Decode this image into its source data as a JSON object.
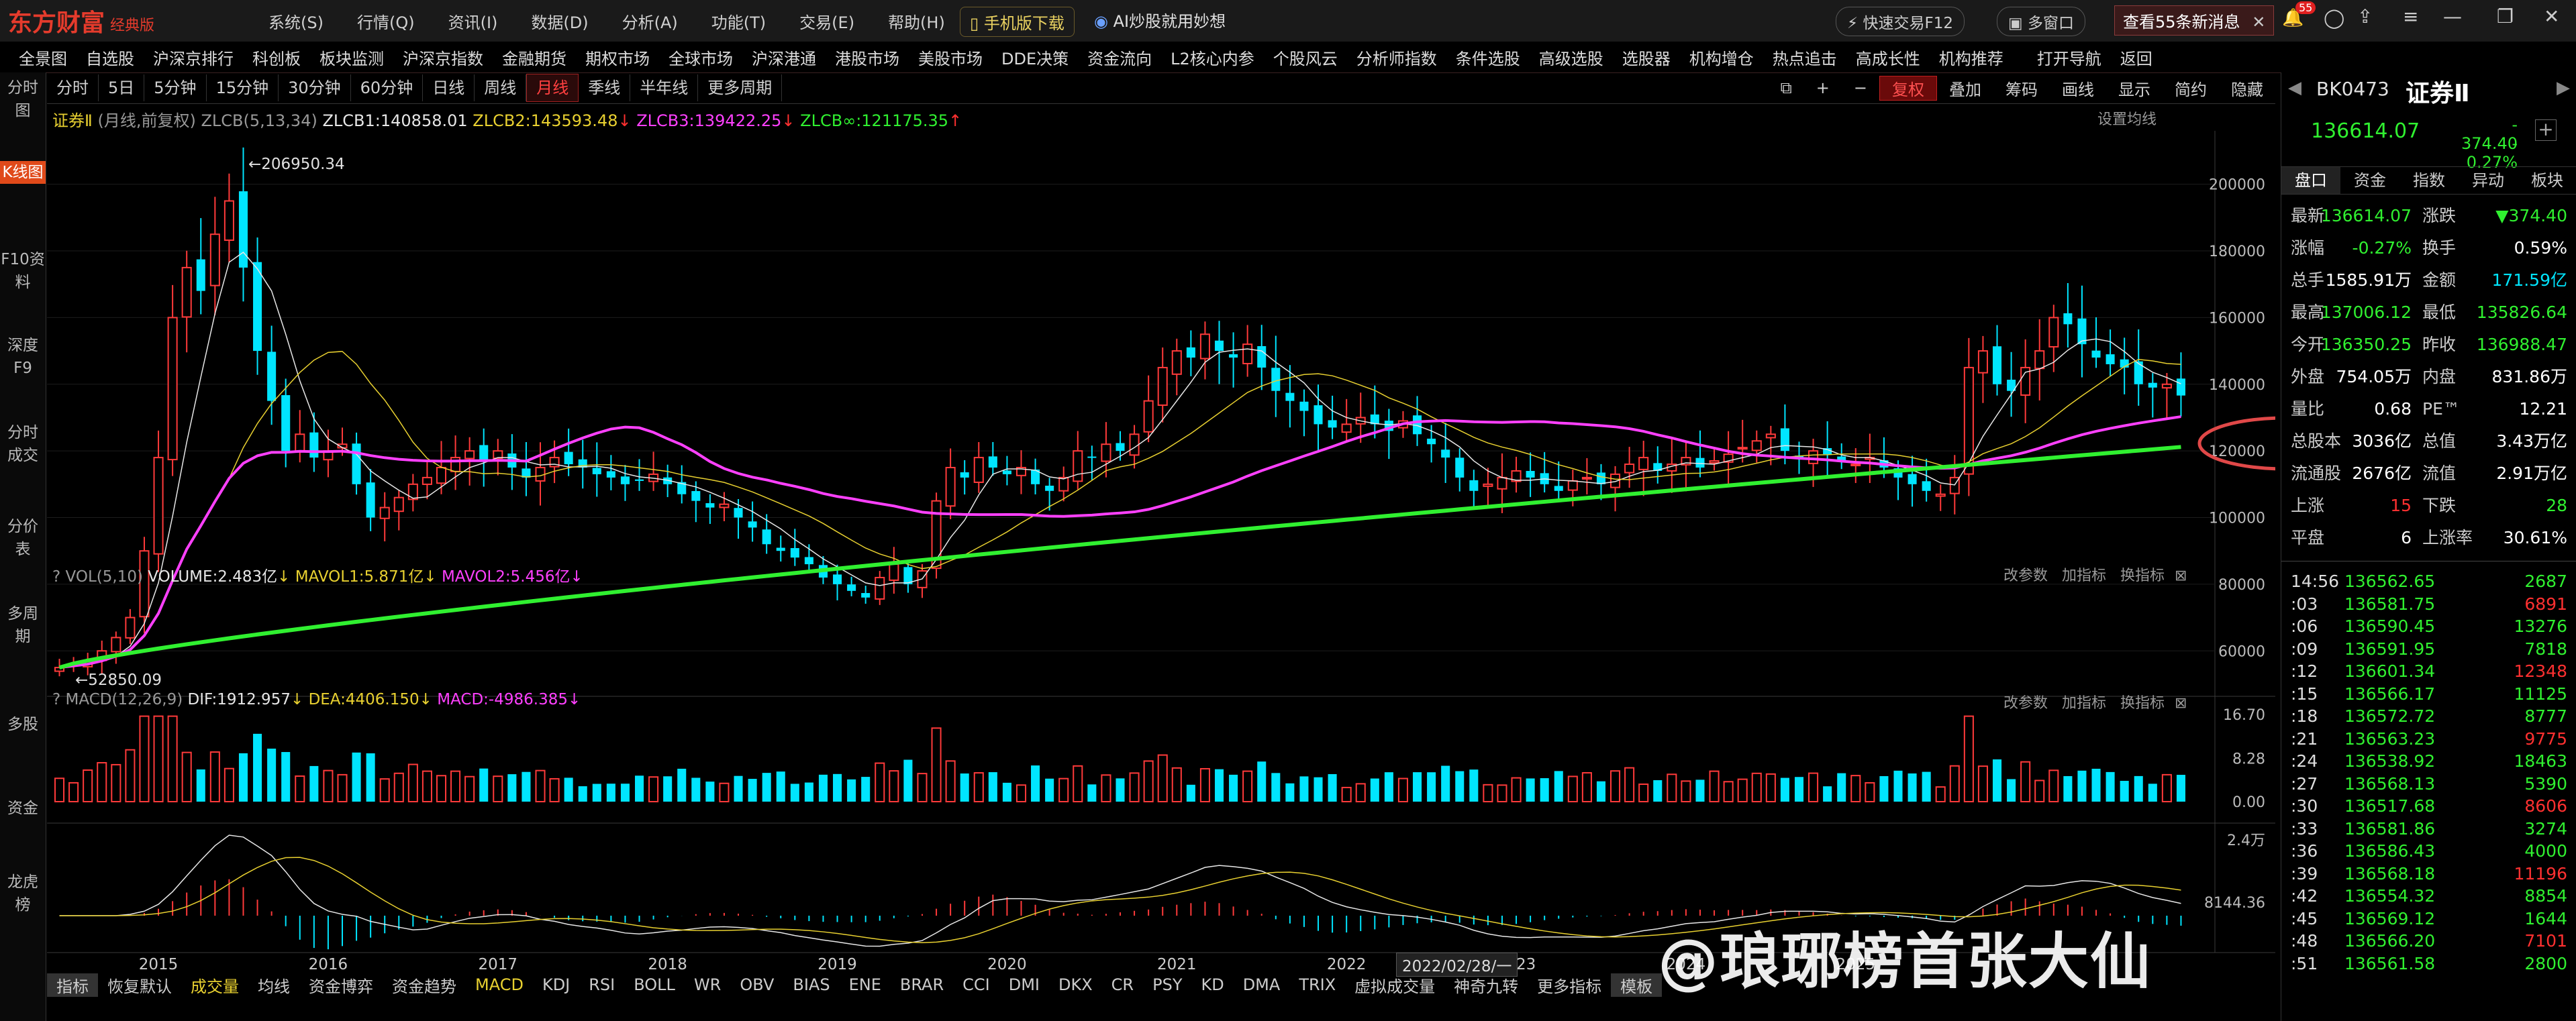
{
  "app": {
    "name": "东方财富",
    "edition": "经典版"
  },
  "menus": [
    "系统(S)",
    "行情(Q)",
    "资讯(I)",
    "数据(D)",
    "分析(A)",
    "功能(T)",
    "交易(E)",
    "帮助(H)"
  ],
  "title_actions": {
    "mobile": "手机版下载",
    "ai": "AI炒股就用妙想",
    "quick_trade": "快速交易F12",
    "multi_window": "多窗口",
    "news": "查看55条新消息",
    "news_badge": "55"
  },
  "navbar": [
    "全景图",
    "自选股",
    "沪深京排行",
    "科创板",
    "板块监测",
    "沪深京指数",
    "金融期货",
    "期权市场",
    "全球市场",
    "沪深港通",
    "港股市场",
    "美股市场",
    "DDE决策",
    "资金流向",
    "L2核心内参",
    "个股风云",
    "分析师指数",
    "条件选股",
    "高级选股",
    "选股器",
    "机构增仓",
    "热点追击",
    "高成长性",
    "机构推荐",
    "打开导航",
    "返回"
  ],
  "left_tabs": [
    "分时图",
    "K线图",
    "F10资料",
    "深度F9",
    "分时成交",
    "分价表",
    "多周期",
    "多股",
    "资金",
    "龙虎榜"
  ],
  "timeframes": [
    "分时",
    "5日",
    "5分钟",
    "15分钟",
    "30分钟",
    "60分钟",
    "日线",
    "周线",
    "月线",
    "季线",
    "半年线",
    "更多周期"
  ],
  "timeframe_selected": "月线",
  "chart_tools": [
    "复权",
    "叠加",
    "筹码",
    "画线",
    "显示",
    "简约",
    "隐藏"
  ],
  "legend": {
    "name": "证券Ⅱ",
    "period": "(月线,前复权)",
    "indicator": "ZLCB(5,13,34)",
    "zlcb1": "ZLCB1:140858.01",
    "zlcb2": "ZLCB2:143593.48",
    "zlcb3": "ZLCB3:139422.25",
    "zlcbinf": "ZLCB∞:121175.35",
    "setting": "设置均线"
  },
  "vol_legend": {
    "name": "VOL(5,10)",
    "volume": "VOLUME:2.483亿",
    "mavol1": "MAVOL1:5.871亿",
    "mavol2": "MAVOL2:5.456亿"
  },
  "macd_legend": {
    "name": "MACD(12,26,9)",
    "dif": "DIF:1912.957",
    "dea": "DEA:4406.150",
    "macd": "MACD:-4986.385"
  },
  "panel_actions": [
    "改参数",
    "加指标",
    "换指标"
  ],
  "max_label": "206950.34",
  "min_label": "52850.09",
  "cursor_date": "2022/02/28/一",
  "bottom_tabs": [
    "指标",
    "恢复默认",
    "成交量",
    "均线",
    "资金博弈",
    "资金趋势",
    "MACD",
    "KDJ",
    "RSI",
    "BOLL",
    "WR",
    "OBV",
    "BIAS",
    "ENE",
    "BRAR",
    "CCI",
    "DMI",
    "DKX",
    "CR",
    "PSY",
    "KD",
    "DMA",
    "TRIX",
    "虚拟成交量",
    "神奇九转",
    "更多指标",
    "模板"
  ],
  "quote": {
    "code": "BK0473",
    "name": "证券Ⅱ",
    "price": "136614.07",
    "change": "- 374.40",
    "pct": "- 0.27%"
  },
  "panel_tabs": [
    "盘口",
    "资金",
    "指数",
    "异动",
    "板块"
  ],
  "stats": [
    {
      "k1": "最新",
      "v1": "136614.07",
      "k2": "涨跌",
      "v2": "▼374.40"
    },
    {
      "k1": "涨幅",
      "v1": "-0.27%",
      "k2": "换手",
      "v2": "0.59%"
    },
    {
      "k1": "总手",
      "v1": "1585.91万",
      "k2": "金额",
      "v2": "171.59亿"
    },
    {
      "k1": "最高",
      "v1": "137006.12",
      "k2": "最低",
      "v2": "135826.64"
    },
    {
      "k1": "今开",
      "v1": "136350.25",
      "k2": "昨收",
      "v2": "136988.47"
    },
    {
      "k1": "外盘",
      "v1": "754.05万",
      "k2": "内盘",
      "v2": "831.86万"
    },
    {
      "k1": "量比",
      "v1": "0.68",
      "k2": "PE™",
      "v2": "12.21"
    },
    {
      "k1": "总股本",
      "v1": "3036亿",
      "k2": "总值",
      "v2": "3.43万亿"
    },
    {
      "k1": "流通股",
      "v1": "2676亿",
      "k2": "流值",
      "v2": "2.91万亿"
    },
    {
      "k1": "上涨",
      "v1": "15",
      "k2": "下跌",
      "v2": "28"
    },
    {
      "k1": "平盘",
      "v1": "6",
      "k2": "上涨率",
      "v2": "30.61%"
    }
  ],
  "ticks": [
    {
      "t": "14:56",
      "p": "136562.65",
      "v": "2687"
    },
    {
      "t": ":03",
      "p": "136581.75",
      "v": "6891"
    },
    {
      "t": ":06",
      "p": "136590.45",
      "v": "13276"
    },
    {
      "t": ":09",
      "p": "136591.95",
      "v": "7818"
    },
    {
      "t": ":12",
      "p": "136601.34",
      "v": "12348"
    },
    {
      "t": ":15",
      "p": "136566.17",
      "v": "11125"
    },
    {
      "t": ":18",
      "p": "136572.72",
      "v": "8777"
    },
    {
      "t": ":21",
      "p": "136563.23",
      "v": "9775"
    },
    {
      "t": ":24",
      "p": "136538.92",
      "v": "18463"
    },
    {
      "t": ":27",
      "p": "136568.13",
      "v": "5390"
    },
    {
      "t": ":30",
      "p": "136517.68",
      "v": "8606"
    },
    {
      "t": ":33",
      "p": "136581.86",
      "v": "3274"
    },
    {
      "t": ":36",
      "p": "136586.43",
      "v": "4000"
    },
    {
      "t": ":39",
      "p": "136568.18",
      "v": "11196"
    },
    {
      "t": ":42",
      "p": "136554.32",
      "v": "8854"
    },
    {
      "t": ":45",
      "p": "136569.12",
      "v": "1644"
    },
    {
      "t": ":48",
      "p": "136566.20",
      "v": "7101"
    },
    {
      "t": ":51",
      "p": "136561.58",
      "v": "2800"
    }
  ],
  "watermark": "@琅琊榜首张大仙",
  "chart_data": {
    "type": "candlestick",
    "title": "证券Ⅱ",
    "period": "月线",
    "x_range": [
      "2014-06",
      "2025-05"
    ],
    "x_tick_labels": [
      "2015",
      "2016",
      "2017",
      "2018",
      "2019",
      "2020",
      "2021",
      "2022",
      "2023",
      "2024",
      "2025"
    ],
    "y_ticks": [
      60000,
      80000,
      100000,
      120000,
      140000,
      160000,
      180000,
      200000
    ],
    "ylim": [
      52000,
      210000
    ],
    "closes": [
      55000,
      56000,
      57000,
      60000,
      64000,
      70000,
      90000,
      118000,
      160000,
      175000,
      168000,
      185000,
      195000,
      175000,
      150000,
      135000,
      120000,
      125000,
      118000,
      120000,
      122000,
      110000,
      100000,
      103000,
      106000,
      110000,
      112000,
      115000,
      118000,
      120000,
      117000,
      120000,
      115000,
      112000,
      115000,
      118000,
      116000,
      115000,
      113000,
      112000,
      110000,
      111000,
      113000,
      110000,
      107000,
      105000,
      103000,
      104000,
      100000,
      97000,
      92000,
      90000,
      88000,
      86000,
      82000,
      80000,
      78000,
      76000,
      82000,
      86000,
      80000,
      84000,
      105000,
      115000,
      112000,
      118000,
      115000,
      113000,
      115000,
      110000,
      108000,
      112000,
      120000,
      118000,
      122000,
      120000,
      125000,
      135000,
      145000,
      150000,
      148000,
      155000,
      150000,
      148000,
      152000,
      145000,
      138000,
      135000,
      132000,
      128000,
      127000,
      128000,
      130000,
      128000,
      126000,
      129000,
      125000,
      122000,
      118000,
      112000,
      108000,
      110000,
      112000,
      114000,
      112000,
      110000,
      108000,
      111000,
      112000,
      110000,
      113000,
      116000,
      118000,
      114000,
      116000,
      118000,
      115000,
      117000,
      119000,
      121000,
      123000,
      125000,
      120000,
      118000,
      120000,
      119000,
      117000,
      116000,
      118000,
      115000,
      112000,
      110000,
      108000,
      107000,
      112000,
      145000,
      150000,
      140000,
      138000,
      145000,
      150000,
      160000,
      158000,
      152000,
      148000,
      146000,
      145000,
      140000,
      139000,
      140000,
      136614
    ],
    "series": [
      {
        "name": "ZLCB1",
        "value": 140858.01,
        "color": "#e8d030"
      },
      {
        "name": "ZLCB2",
        "value": 143593.48,
        "color": "#ff40ff"
      },
      {
        "name": "ZLCB3",
        "value": 139422.25,
        "color": "#ff40ff"
      },
      {
        "name": "ZLCB∞",
        "value": 121175.35,
        "color": "#30f030"
      }
    ],
    "volume_axis": [
      0,
      8.28,
      16.7
    ],
    "macd_axis": [
      "2.4万",
      "8144.36"
    ]
  }
}
